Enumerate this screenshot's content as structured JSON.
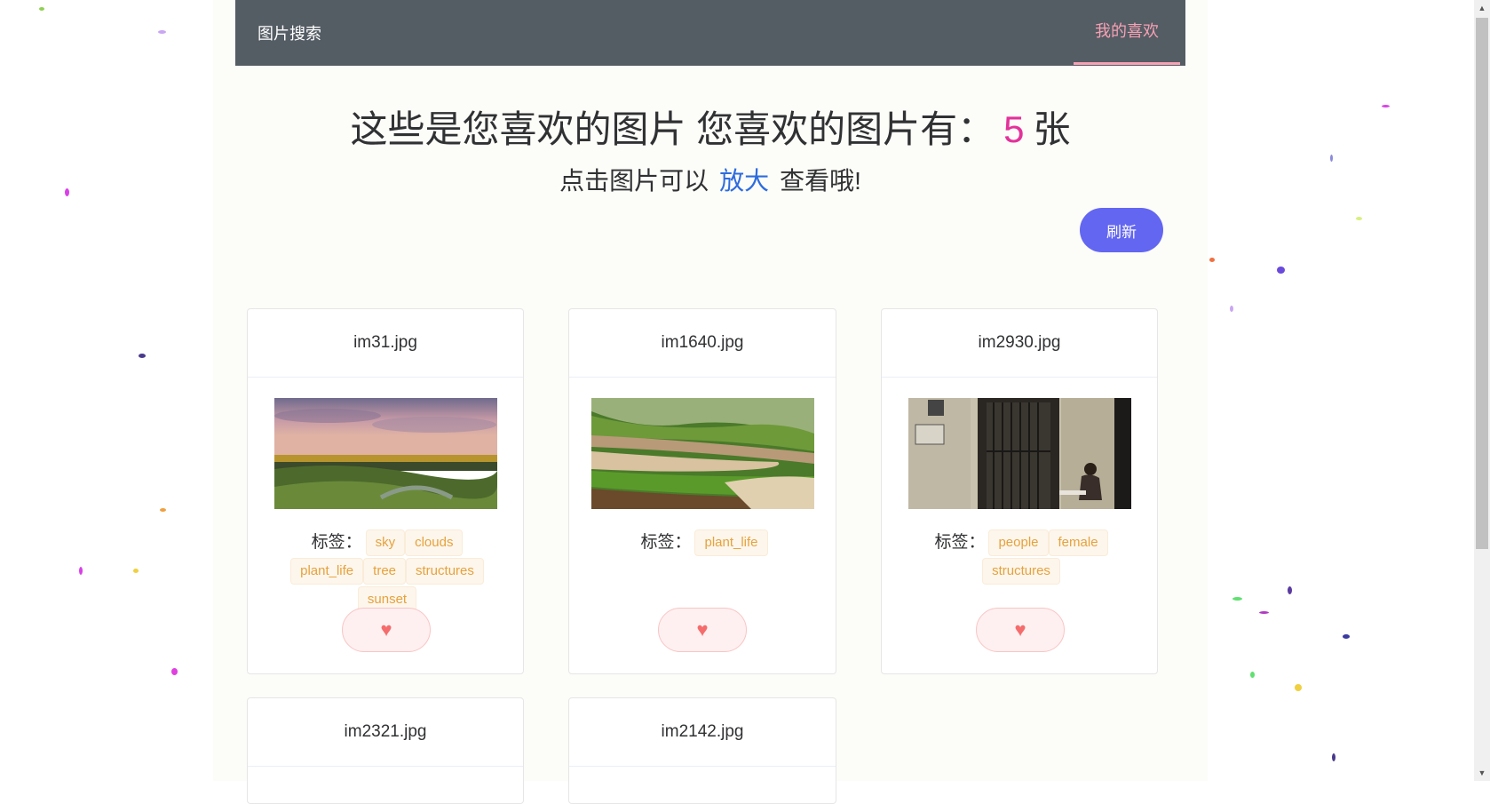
{
  "nav": {
    "brand": "图片搜索",
    "favorites": "我的喜欢"
  },
  "header": {
    "title_prefix": "这些是您喜欢的图片 您喜欢的图片有：",
    "count": "5",
    "title_suffix": "张",
    "hint_prefix": "点击图片可以",
    "hint_link": "放大",
    "hint_suffix": "查看哦!"
  },
  "refresh_label": "刷新",
  "tags_label": "标签：",
  "like_icon": "heart-icon",
  "colors": {
    "navbar": "#545c64",
    "accent_pink": "#f7a1b3",
    "count": "#e3329a",
    "link": "#2d6cdf",
    "refresh": "#6366f1",
    "tag_text": "#e6a23c"
  },
  "cards": [
    {
      "name": "im31.jpg",
      "tags": [
        "sky",
        "clouds",
        "plant_life",
        "tree",
        "structures",
        "sunset"
      ]
    },
    {
      "name": "im1640.jpg",
      "tags": [
        "plant_life"
      ]
    },
    {
      "name": "im2930.jpg",
      "tags": [
        "people",
        "female",
        "structures"
      ]
    },
    {
      "name": "im2321.jpg",
      "tags": []
    },
    {
      "name": "im2142.jpg",
      "tags": []
    }
  ]
}
